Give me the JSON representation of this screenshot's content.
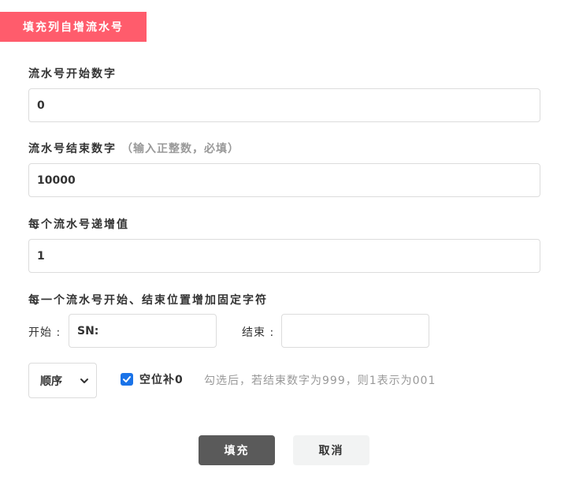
{
  "header": {
    "title": "填充列自增流水号"
  },
  "start_number": {
    "label": "流水号开始数字",
    "value": "0"
  },
  "end_number": {
    "label": "流水号结束数字",
    "hint": "（输入正整数，必填）",
    "value": "10000"
  },
  "increment": {
    "label": "每个流水号递增值",
    "value": "1"
  },
  "affix": {
    "label": "每一个流水号开始、结束位置增加固定字符",
    "prefix_label": "开始 :",
    "prefix_value": "SN:",
    "suffix_label": "结束 :",
    "suffix_value": ""
  },
  "order_select": {
    "selected": "顺序"
  },
  "zero_pad": {
    "label": "空位补0",
    "checked": true,
    "hint": "勾选后，若结束数字为999，则1表示为001"
  },
  "buttons": {
    "fill": "填充",
    "cancel": "取消"
  },
  "colors": {
    "accent": "#ff5c6c",
    "checkbox": "#1a73e8",
    "primary_button": "#5a5a5a"
  },
  "icons": {
    "select_arrow": "chevron-down-icon",
    "checkbox": "check-icon"
  }
}
